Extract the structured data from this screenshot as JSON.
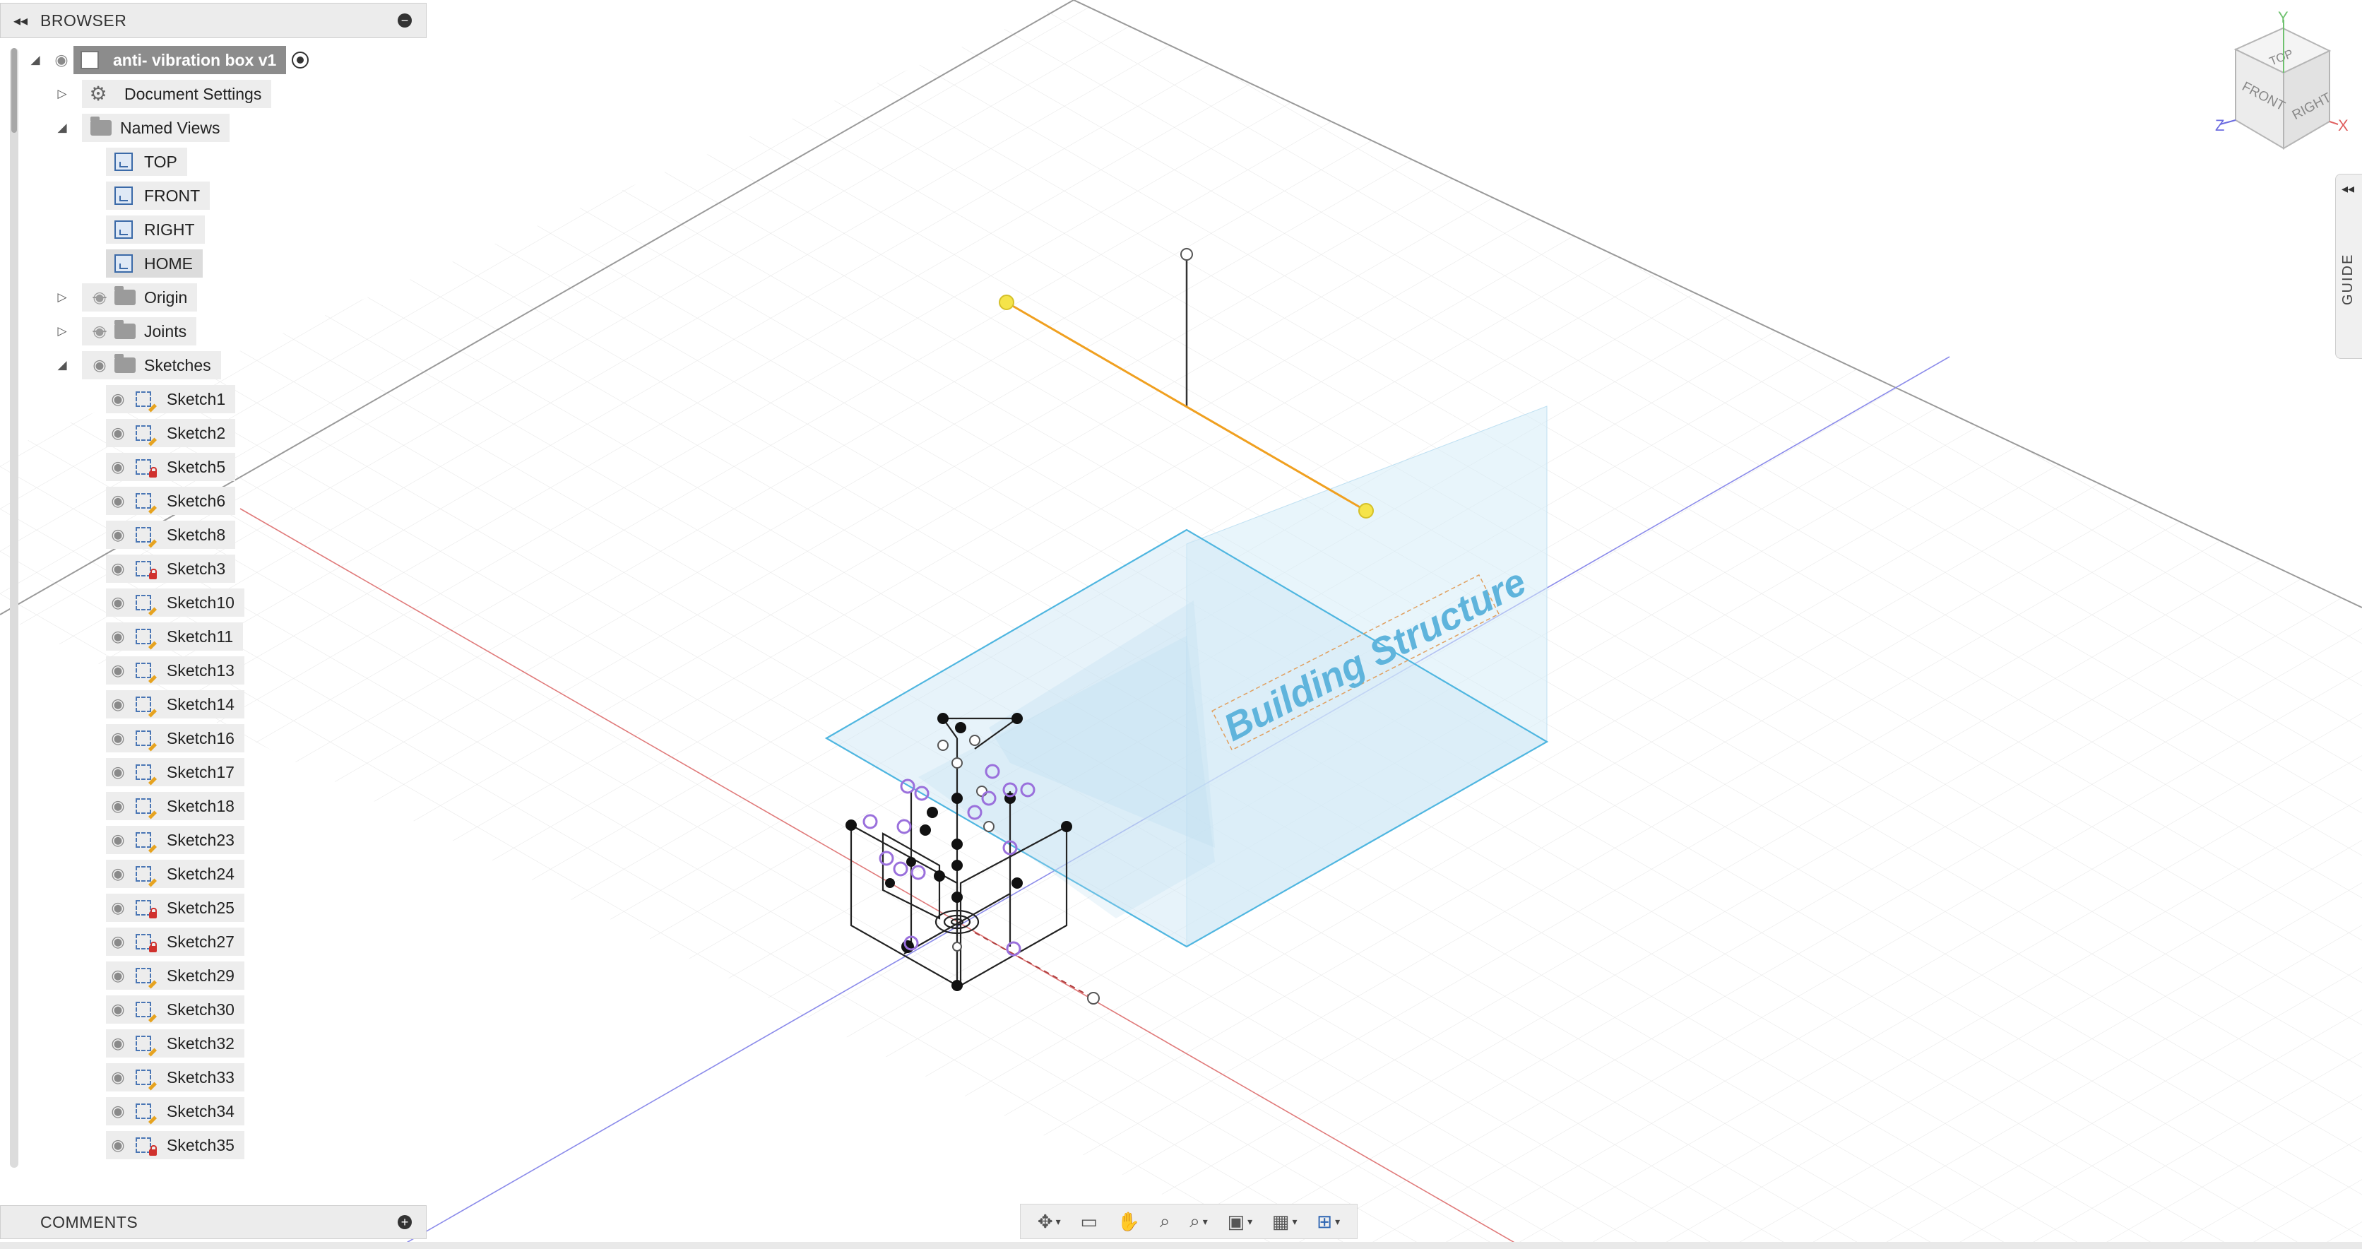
{
  "browser": {
    "title": "BROWSER",
    "root": "anti- vibration box v1",
    "document_settings": "Document Settings",
    "named_views": {
      "label": "Named Views",
      "items": [
        "TOP",
        "FRONT",
        "RIGHT",
        "HOME"
      ]
    },
    "origin": "Origin",
    "joints": "Joints",
    "sketches": {
      "label": "Sketches",
      "items": [
        {
          "label": "Sketch1",
          "icon": "sketch-icon"
        },
        {
          "label": "Sketch2",
          "icon": "sketch-icon"
        },
        {
          "label": "Sketch5",
          "icon": "locked-sketch-icon"
        },
        {
          "label": "Sketch6",
          "icon": "sketch-icon"
        },
        {
          "label": "Sketch8",
          "icon": "sketch-icon"
        },
        {
          "label": "Sketch3",
          "icon": "locked-sketch-icon"
        },
        {
          "label": "Sketch10",
          "icon": "sketch-icon"
        },
        {
          "label": "Sketch11",
          "icon": "sketch-icon"
        },
        {
          "label": "Sketch13",
          "icon": "sketch-icon"
        },
        {
          "label": "Sketch14",
          "icon": "sketch-icon"
        },
        {
          "label": "Sketch16",
          "icon": "sketch-icon"
        },
        {
          "label": "Sketch17",
          "icon": "sketch-icon"
        },
        {
          "label": "Sketch18",
          "icon": "sketch-icon"
        },
        {
          "label": "Sketch23",
          "icon": "sketch-icon"
        },
        {
          "label": "Sketch24",
          "icon": "sketch-icon"
        },
        {
          "label": "Sketch25",
          "icon": "locked-sketch-icon"
        },
        {
          "label": "Sketch27",
          "icon": "locked-sketch-icon"
        },
        {
          "label": "Sketch29",
          "icon": "sketch-icon"
        },
        {
          "label": "Sketch30",
          "icon": "sketch-icon"
        },
        {
          "label": "Sketch32",
          "icon": "sketch-icon"
        },
        {
          "label": "Sketch33",
          "icon": "sketch-icon"
        },
        {
          "label": "Sketch34",
          "icon": "sketch-icon"
        },
        {
          "label": "Sketch35",
          "icon": "locked-sketch-icon"
        }
      ]
    }
  },
  "comments": {
    "title": "COMMENTS"
  },
  "viewport": {
    "sketch_text": "Building Structure",
    "viewcube": {
      "top": "TOP",
      "front": "FRONT",
      "right": "RIGHT",
      "axis_x": "X",
      "axis_y": "Y",
      "axis_z": "Z"
    }
  },
  "guide": {
    "label": "GUIDE"
  },
  "navbar": {
    "tools": [
      "orbit-icon",
      "look-at-icon",
      "pan-icon",
      "zoom-icon",
      "fit-icon",
      "display-settings-icon",
      "grid-icon",
      "viewports-icon"
    ]
  },
  "colors": {
    "panel_bg": "#ececec",
    "sketch_line": "#4fb6e0",
    "axis_red": "#e05050",
    "axis_blue": "#6a6ae0",
    "highlight_orange": "#f0a020"
  }
}
